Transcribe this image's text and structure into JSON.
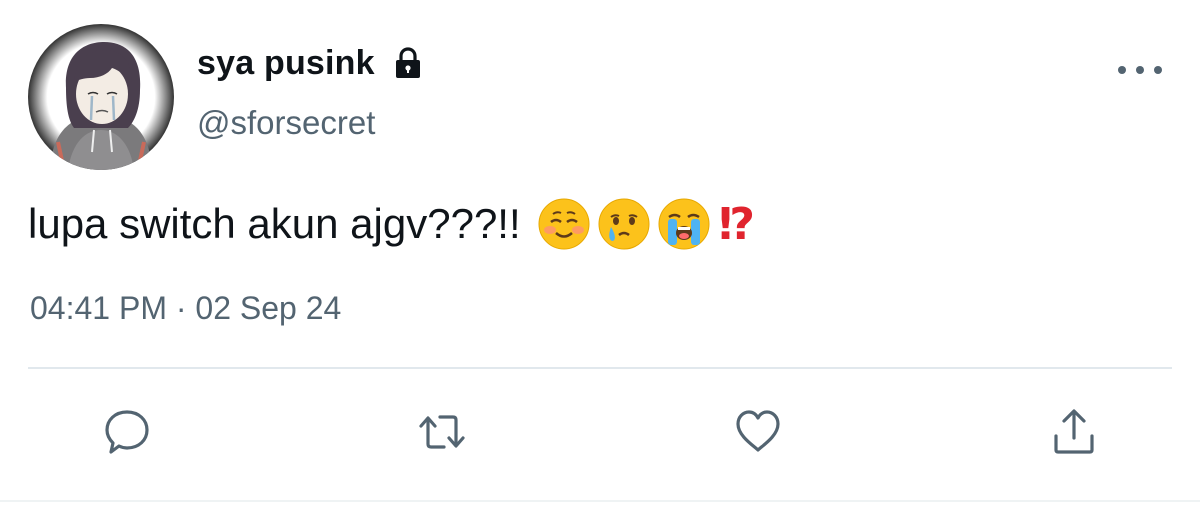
{
  "tweet": {
    "display_name": "sya pusink",
    "handle": "@sforsecret",
    "text": "lupa switch akun ajgv???!!",
    "emojis": [
      "smiling-face-emoji",
      "face-holding-back-tears-emoji",
      "loudly-crying-face-emoji"
    ],
    "exclamation_question": "⁉",
    "timestamp": "04:41 PM · 02 Sep 24",
    "icons": {
      "lock": "lock-icon",
      "more": "more-icon",
      "reply": "reply-icon",
      "retweet": "retweet-icon",
      "like": "heart-icon",
      "share": "share-icon"
    },
    "colors": {
      "text_primary": "#0f1419",
      "text_secondary": "#536471",
      "divider": "#e1e8ed",
      "accent_red": "#e0242e"
    }
  }
}
